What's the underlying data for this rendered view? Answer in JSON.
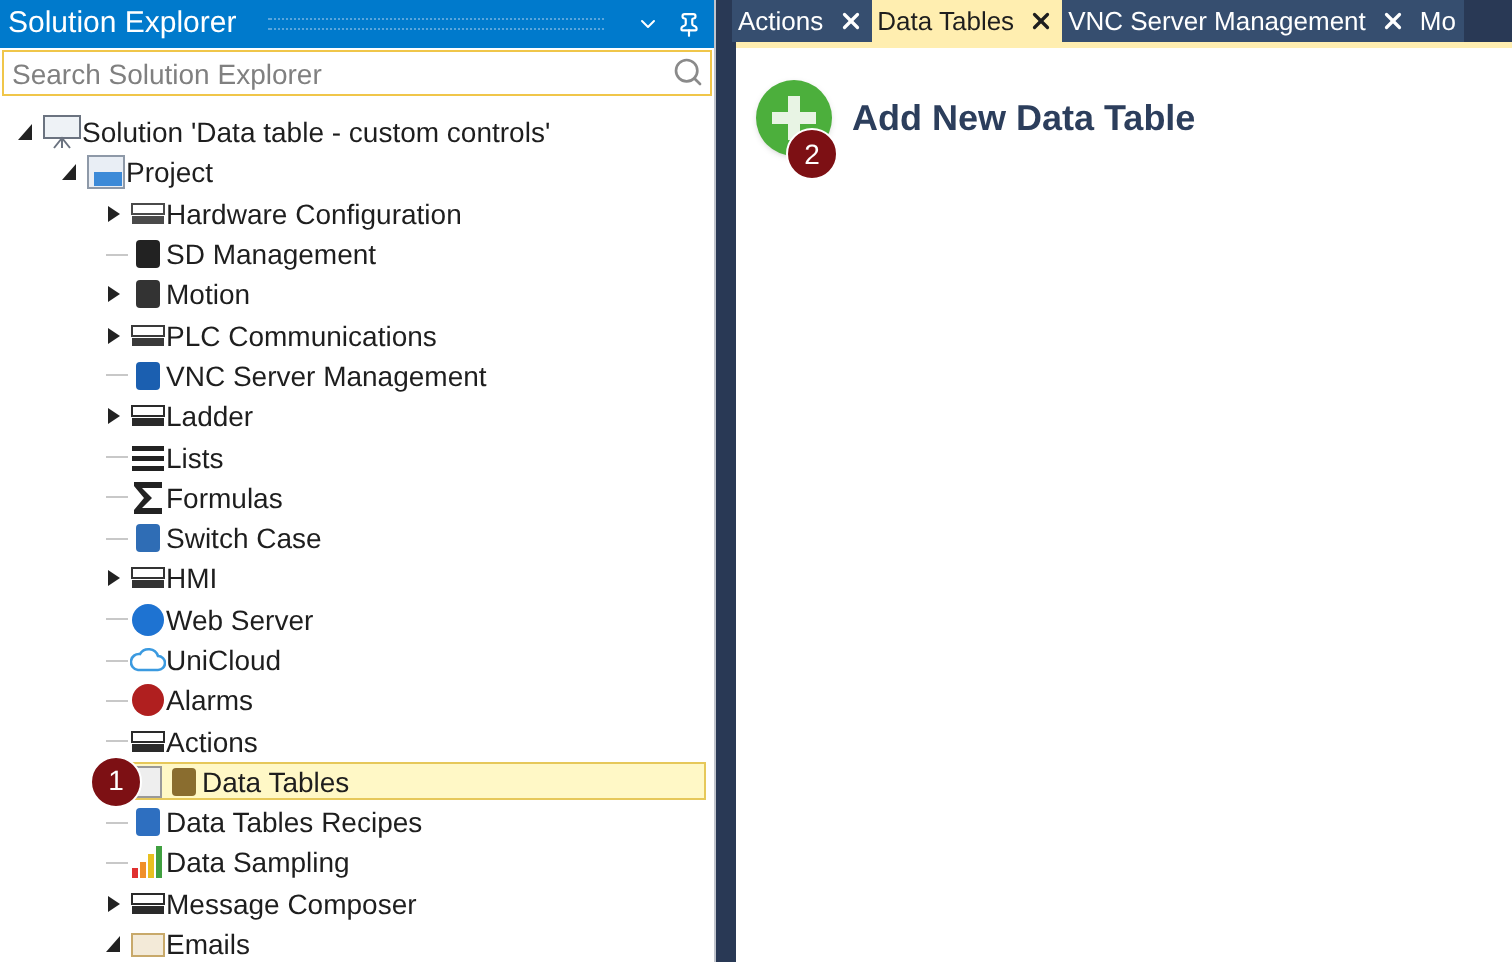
{
  "explorer": {
    "title": "Solution Explorer",
    "search": {
      "placeholder": "Search Solution Explorer"
    },
    "tree": [
      {
        "label": "Solution 'Data table - custom controls'",
        "expanded": true,
        "selected": false,
        "children": [
          {
            "label": "Project",
            "expanded": true,
            "selected": false,
            "children": [
              {
                "label": "Hardware Configuration",
                "expanded": false,
                "selected": false
              },
              {
                "label": "SD Management",
                "selected": false
              },
              {
                "label": "Motion",
                "expanded": false,
                "selected": false
              },
              {
                "label": "PLC Communications",
                "expanded": false,
                "selected": false
              },
              {
                "label": "VNC Server Management",
                "selected": false
              },
              {
                "label": "Ladder",
                "expanded": false,
                "selected": false
              },
              {
                "label": "Lists",
                "selected": false
              },
              {
                "label": "Formulas",
                "selected": false
              },
              {
                "label": "Switch Case",
                "selected": false
              },
              {
                "label": "HMI",
                "expanded": false,
                "selected": false
              },
              {
                "label": "Web Server",
                "selected": false
              },
              {
                "label": "UniCloud",
                "selected": false
              },
              {
                "label": "Alarms",
                "selected": false
              },
              {
                "label": "Actions",
                "selected": false
              },
              {
                "label": "Data Tables",
                "selected": true,
                "callout": "1"
              },
              {
                "label": "Data Tables Recipes",
                "selected": false
              },
              {
                "label": "Data Sampling",
                "selected": false
              },
              {
                "label": "Message Composer",
                "expanded": false,
                "selected": false
              },
              {
                "label": "Emails",
                "expanded": true,
                "selected": false
              }
            ]
          }
        ]
      }
    ]
  },
  "tabs": [
    {
      "label": "Actions",
      "selected": false
    },
    {
      "label": "Data Tables",
      "selected": true
    },
    {
      "label": "VNC Server Management",
      "selected": false
    },
    {
      "label": "Mo",
      "selected": false
    }
  ],
  "add_button": {
    "label": "Add New Data Table",
    "callout": "2"
  }
}
